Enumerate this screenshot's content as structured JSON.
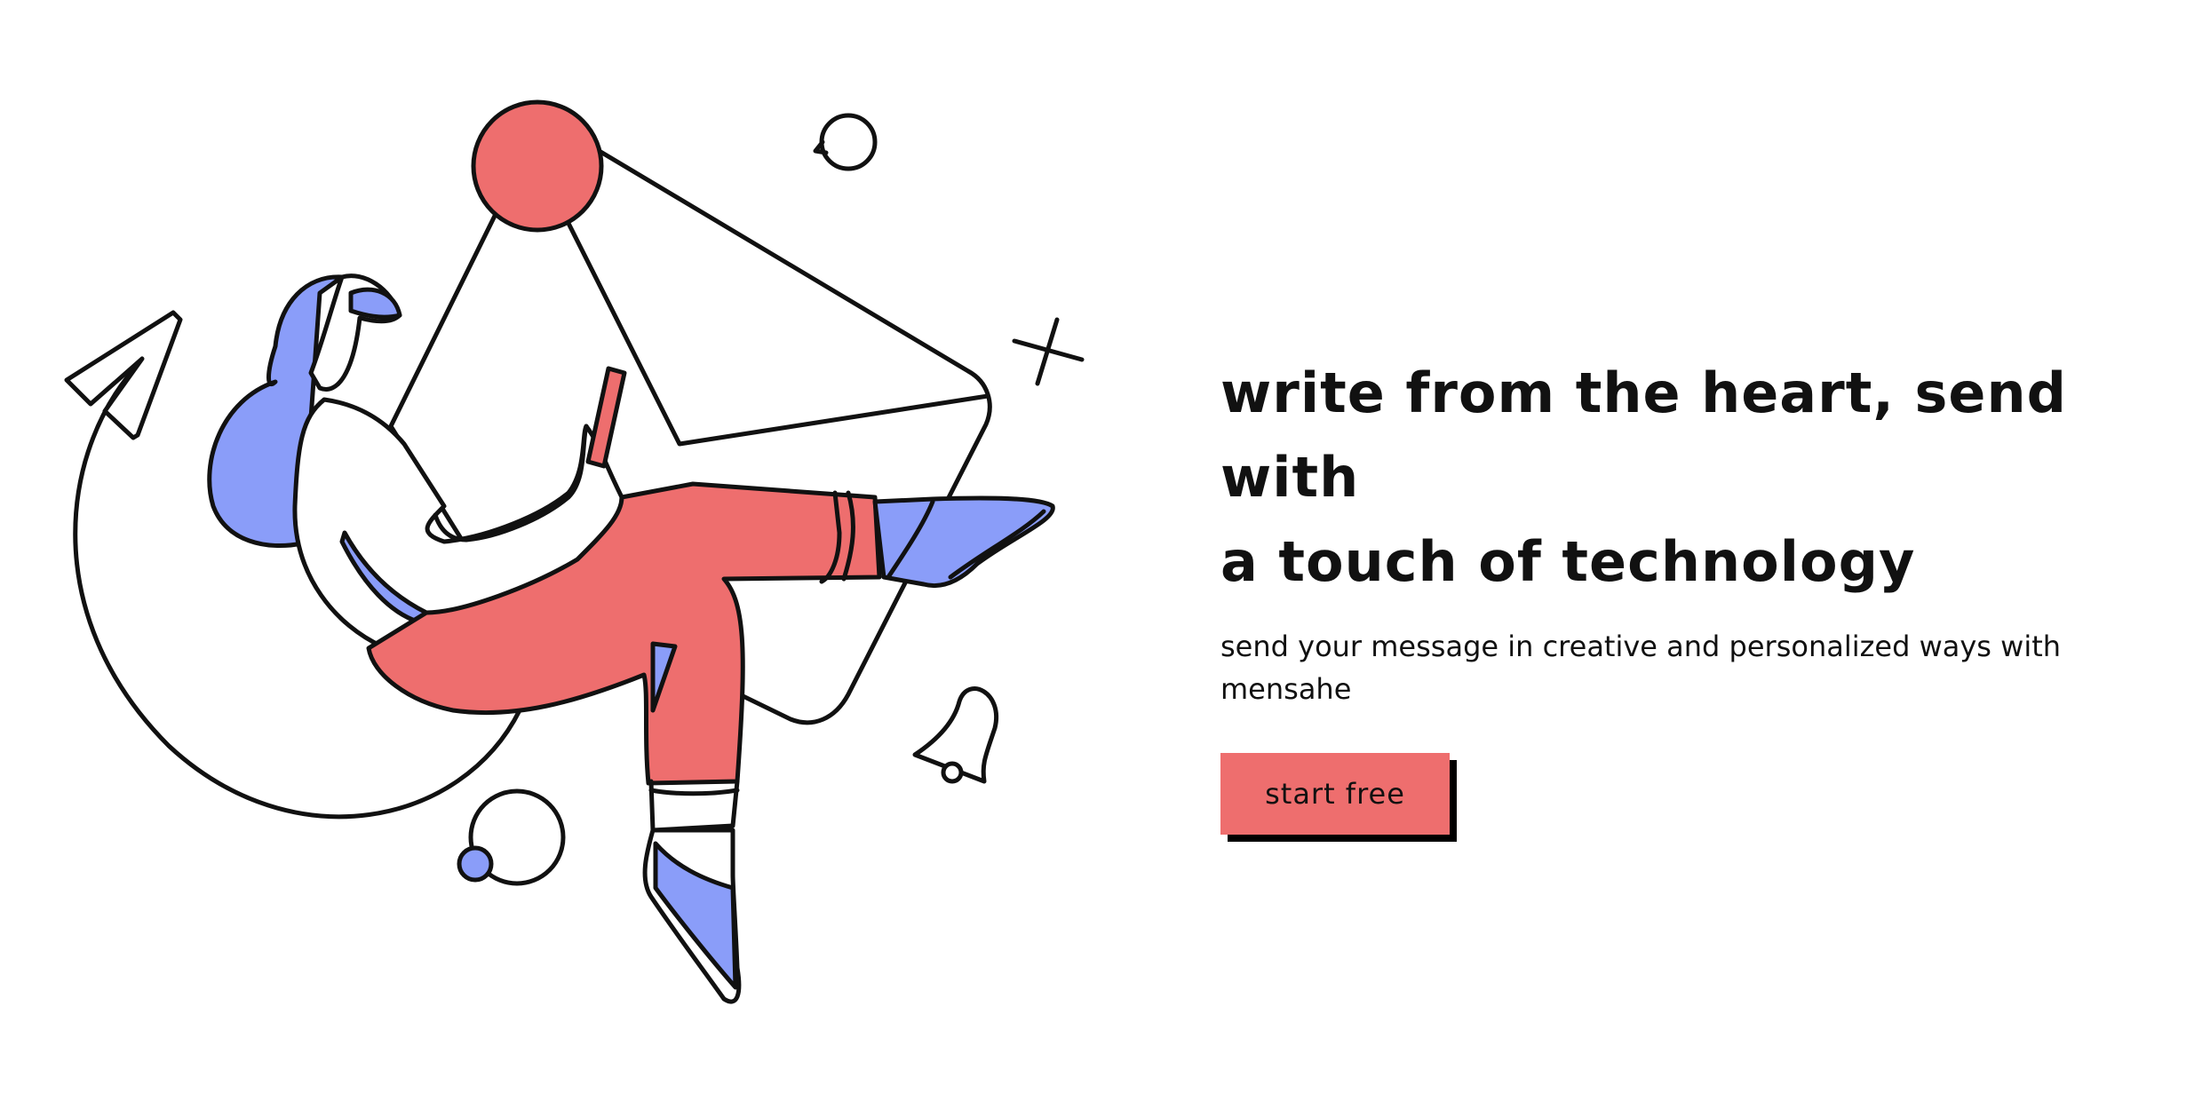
{
  "hero": {
    "heading_line1": "write from the heart, send with",
    "heading_line2": "a touch of technology",
    "subtitle": "send your message in creative and personalized ways with mensahe",
    "cta_label": "start free"
  },
  "illustration": {
    "icons": [
      "woman-with-phone",
      "envelope-icon",
      "paper-plane-icon",
      "speech-bubble-icon",
      "bell-icon",
      "sparkle-icon",
      "bubble-circles"
    ]
  },
  "colors": {
    "coral": "#ee6e6e",
    "periwinkle": "#8a9df9",
    "outline": "#111111",
    "background": "#ffffff"
  }
}
